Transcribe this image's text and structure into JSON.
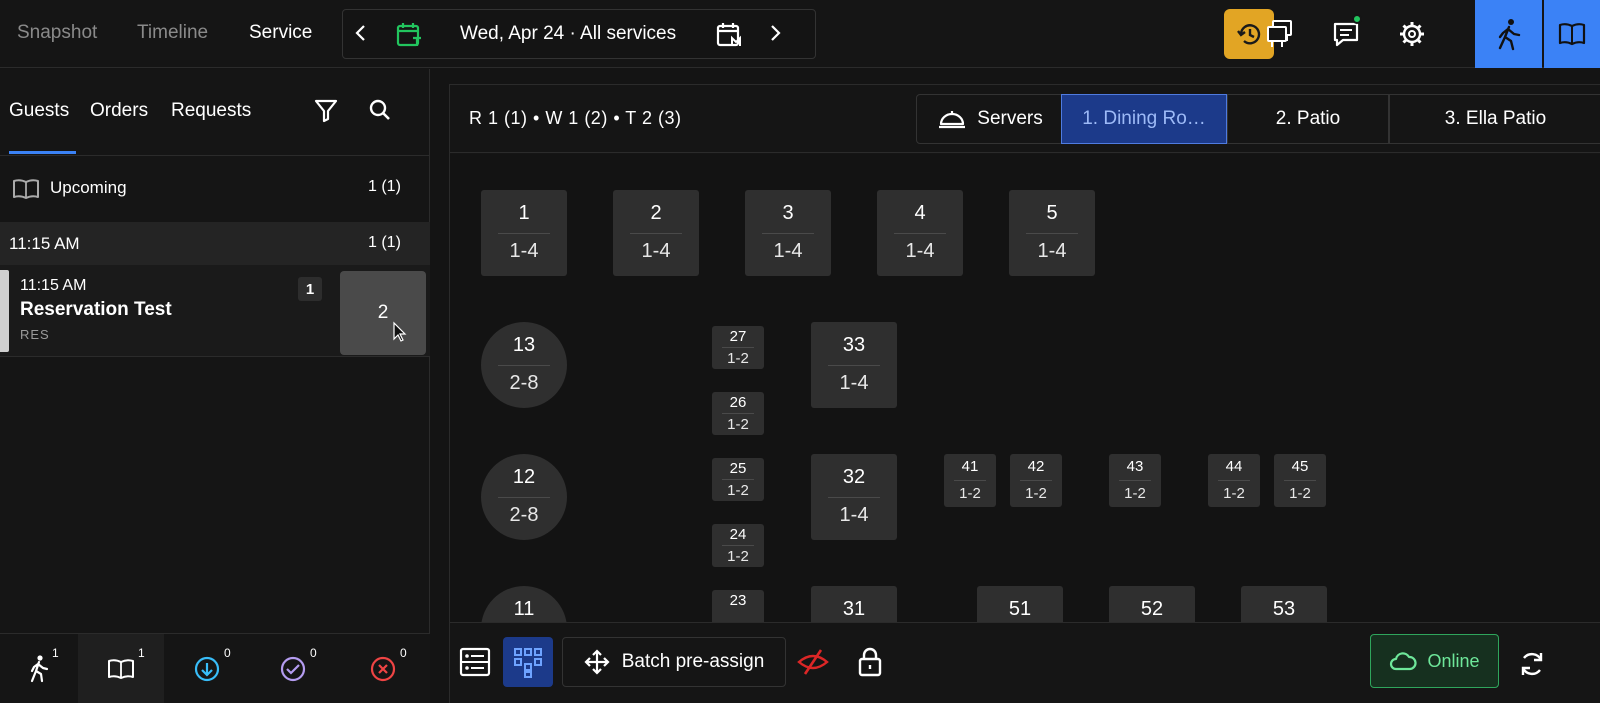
{
  "nav": {
    "tabs": [
      "Snapshot",
      "Timeline",
      "Service"
    ],
    "active_tab": "Service",
    "date_label": "Wed, Apr 24 · All services",
    "accent": "#3b82f6",
    "history_color": "#e2a524",
    "icons": [
      "chevron-left-icon",
      "calendar-icon",
      "calendar-m-icon",
      "chevron-right-icon",
      "history-icon",
      "combine-tables-icon",
      "chat-icon",
      "settings-icon",
      "walk-in-icon",
      "book-icon"
    ]
  },
  "left_panel": {
    "tabs": [
      "Guests",
      "Orders",
      "Requests"
    ],
    "upcoming": {
      "label": "Upcoming",
      "count": "1 (1)"
    },
    "time_group": {
      "label": "11:15 AM",
      "count": "1 (1)"
    },
    "reservation": {
      "time": "11:15 AM",
      "name": "Reservation Test",
      "type": "RES",
      "party_size": "1",
      "table": "2"
    },
    "bottom_counts": [
      "1",
      "1",
      "0",
      "0",
      "0"
    ]
  },
  "main": {
    "counts": "R 1 (1) • W 1 (2) • T 2 (3)",
    "servers_label": "Servers",
    "rooms": [
      "1. Dining Ro…",
      "2. Patio",
      "3. Ella Patio"
    ],
    "active_room": "1. Dining Ro…",
    "batch_label": "Batch pre-assign",
    "online_label": "Online",
    "online_color": "#6ee79a"
  },
  "floor_tables": [
    {
      "num": "1",
      "cap": "1-4"
    },
    {
      "num": "2",
      "cap": "1-4"
    },
    {
      "num": "3",
      "cap": "1-4"
    },
    {
      "num": "4",
      "cap": "1-4"
    },
    {
      "num": "5",
      "cap": "1-4"
    },
    {
      "num": "13",
      "cap": "2-8"
    },
    {
      "num": "12",
      "cap": "2-8"
    },
    {
      "num": "11",
      "cap": ""
    },
    {
      "num": "27",
      "cap": "1-2"
    },
    {
      "num": "26",
      "cap": "1-2"
    },
    {
      "num": "25",
      "cap": "1-2"
    },
    {
      "num": "24",
      "cap": "1-2"
    },
    {
      "num": "23",
      "cap": ""
    },
    {
      "num": "33",
      "cap": "1-4"
    },
    {
      "num": "32",
      "cap": "1-4"
    },
    {
      "num": "31",
      "cap": ""
    },
    {
      "num": "41",
      "cap": "1-2"
    },
    {
      "num": "42",
      "cap": "1-2"
    },
    {
      "num": "43",
      "cap": "1-2"
    },
    {
      "num": "44",
      "cap": "1-2"
    },
    {
      "num": "45",
      "cap": "1-2"
    },
    {
      "num": "51",
      "cap": ""
    },
    {
      "num": "52",
      "cap": ""
    },
    {
      "num": "53",
      "cap": ""
    }
  ]
}
